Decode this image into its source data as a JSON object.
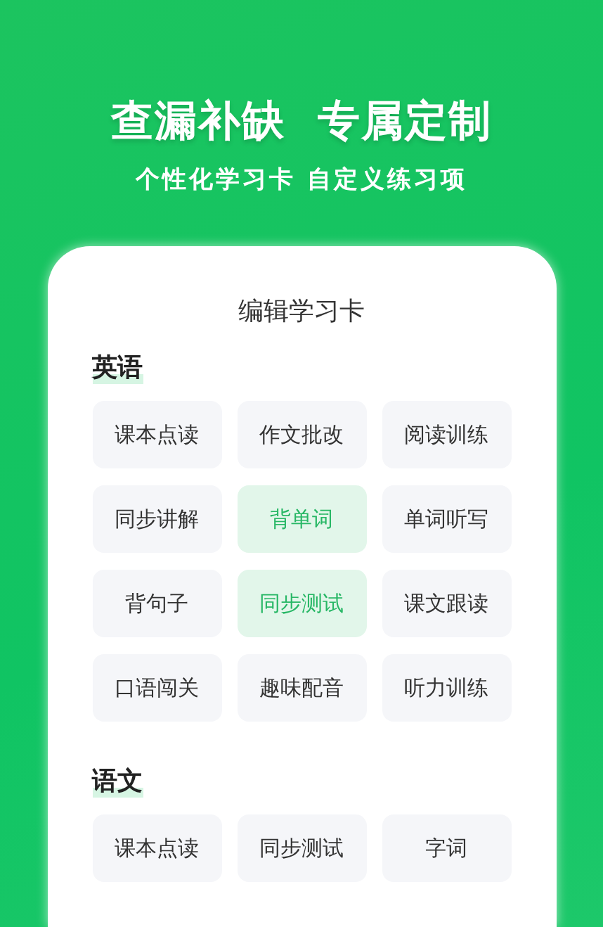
{
  "headline": "查漏补缺  专属定制",
  "subheadline": "个性化学习卡 自定义练习项",
  "card": {
    "title": "编辑学习卡",
    "sections": [
      {
        "title": "英语",
        "items": [
          {
            "label": "课本点读",
            "selected": false
          },
          {
            "label": "作文批改",
            "selected": false
          },
          {
            "label": "阅读训练",
            "selected": false
          },
          {
            "label": "同步讲解",
            "selected": false
          },
          {
            "label": "背单词",
            "selected": true
          },
          {
            "label": "单词听写",
            "selected": false
          },
          {
            "label": "背句子",
            "selected": false
          },
          {
            "label": "同步测试",
            "selected": true
          },
          {
            "label": "课文跟读",
            "selected": false
          },
          {
            "label": "口语闯关",
            "selected": false
          },
          {
            "label": "趣味配音",
            "selected": false
          },
          {
            "label": "听力训练",
            "selected": false
          }
        ]
      },
      {
        "title": "语文",
        "items": [
          {
            "label": "课本点读",
            "selected": false
          },
          {
            "label": "同步测试",
            "selected": false
          },
          {
            "label": "字词",
            "selected": false
          }
        ]
      }
    ]
  }
}
